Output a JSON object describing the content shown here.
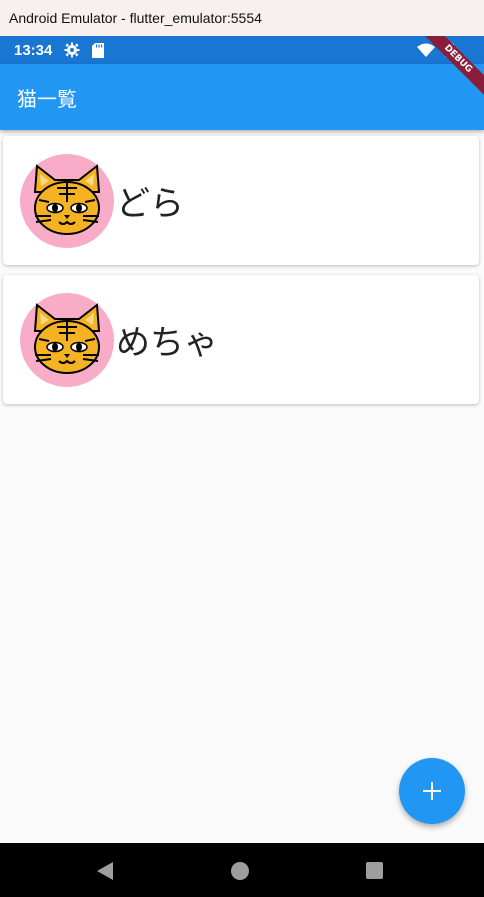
{
  "window": {
    "title": "Android Emulator - flutter_emulator:5554"
  },
  "status_bar": {
    "time": "13:34"
  },
  "debug_banner": {
    "label": "DEBUG"
  },
  "app_bar": {
    "title": "猫一覧"
  },
  "cats": [
    {
      "name": "どら",
      "avatar_icon": "tiger-cat-icon"
    },
    {
      "name": "めちゃ",
      "avatar_icon": "tiger-cat-icon"
    }
  ],
  "fab": {
    "icon": "plus-icon",
    "label": "+"
  },
  "colors": {
    "app_bar": "#2196f3",
    "status_bar": "#1976d2",
    "avatar_bg": "#f9acc8",
    "background": "#fafafa"
  }
}
